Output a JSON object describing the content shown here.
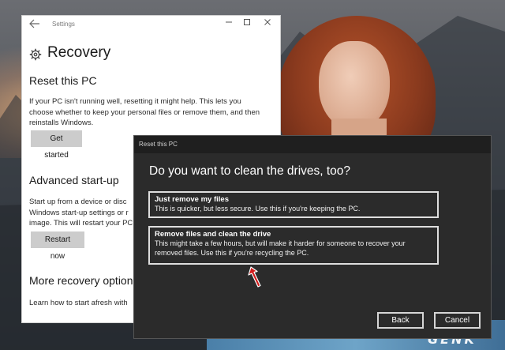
{
  "settings": {
    "app_title": "Settings",
    "page_title": "Recovery",
    "reset_heading": "Reset this PC",
    "reset_text": "If your PC isn't running well, resetting it might help. This lets you choose whether to keep your personal files or remove them, and then reinstalls Windows.",
    "get_started_label": "Get started",
    "advanced_heading": "Advanced start-up",
    "advanced_text": "Start up from a device or disc\nWindows start-up settings or r\nimage. This will restart your PC",
    "restart_label": "Restart now",
    "more_heading": "More recovery options",
    "more_text": "Learn how to start afresh with"
  },
  "dialog": {
    "title": "Reset this PC",
    "question": "Do you want to clean the drives, too?",
    "options": [
      {
        "head": "Just remove my files",
        "desc": "This is quicker, but less secure. Use this if you're keeping the PC."
      },
      {
        "head": "Remove files and clean the drive",
        "desc": "This might take a few hours, but will make it harder for someone to recover your removed files. Use this if you're recycling the PC."
      }
    ],
    "back_label": "Back",
    "cancel_label": "Cancel"
  },
  "watermark": "GENK",
  "colors": {
    "dialog_bg": "#2b2b2b",
    "arrow": "#d01c1c",
    "button_light": "#cccccc"
  },
  "icons": [
    "back-arrow-icon",
    "gear-icon",
    "minimize-icon",
    "maximize-icon",
    "close-icon",
    "red-arrow-icon"
  ]
}
